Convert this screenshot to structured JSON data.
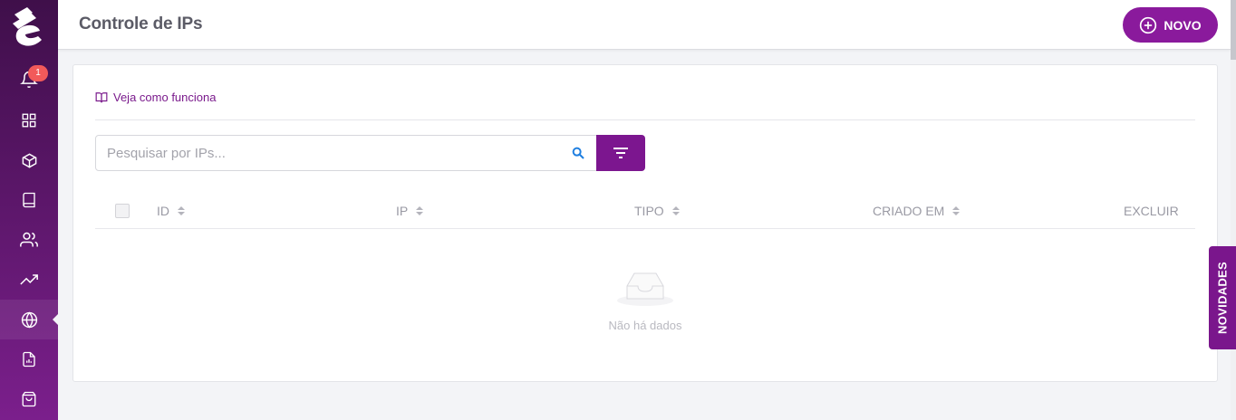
{
  "app": {
    "page_title": "Controle de IPs",
    "new_button_label": "NOVO",
    "notifications_count": "1"
  },
  "sidebar": {
    "items": [
      {
        "icon": "bell-icon"
      },
      {
        "icon": "grid-icon"
      },
      {
        "icon": "box-icon"
      },
      {
        "icon": "book-icon"
      },
      {
        "icon": "users-icon"
      },
      {
        "icon": "trending-up-icon"
      },
      {
        "icon": "globe-icon",
        "active": true
      },
      {
        "icon": "report-icon"
      },
      {
        "icon": "shopping-bag-icon"
      }
    ]
  },
  "help": {
    "label": "Veja como funciona"
  },
  "search": {
    "placeholder": "Pesquisar por IPs...",
    "value": ""
  },
  "table": {
    "columns": [
      "ID",
      "IP",
      "TIPO",
      "CRIADO EM",
      "EXCLUIR"
    ],
    "rows": [],
    "empty_text": "Não há dados"
  },
  "side_tab": {
    "label": "NOVIDADES"
  },
  "colors": {
    "primary": "#8a1a9c",
    "sidebar_top": "#3f0f4a",
    "sidebar_bottom": "#7b1f8c",
    "badge": "#f25a5a"
  }
}
